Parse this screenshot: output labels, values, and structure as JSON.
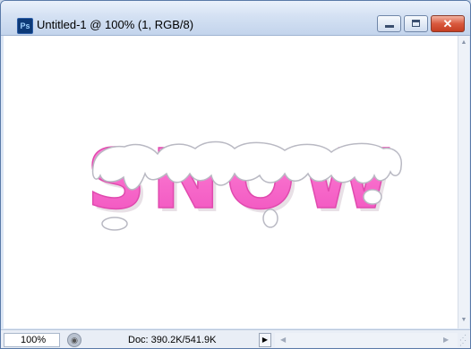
{
  "window": {
    "title": "Untitled-1 @ 100% (1, RGB/8)",
    "app_icon_label": "Ps",
    "close_glyph": "✕"
  },
  "canvas": {
    "text": "SNOW",
    "fill_color": "#ff66cc",
    "snow_color": "#ffffff",
    "background": "#ffffff"
  },
  "status": {
    "zoom": "100%",
    "doc_info": "Doc: 390.2K/541.9K",
    "arrow_glyph": "▶"
  },
  "icons": {
    "minimize": "minimize-icon",
    "maximize": "maximize-icon",
    "close": "close-icon"
  }
}
